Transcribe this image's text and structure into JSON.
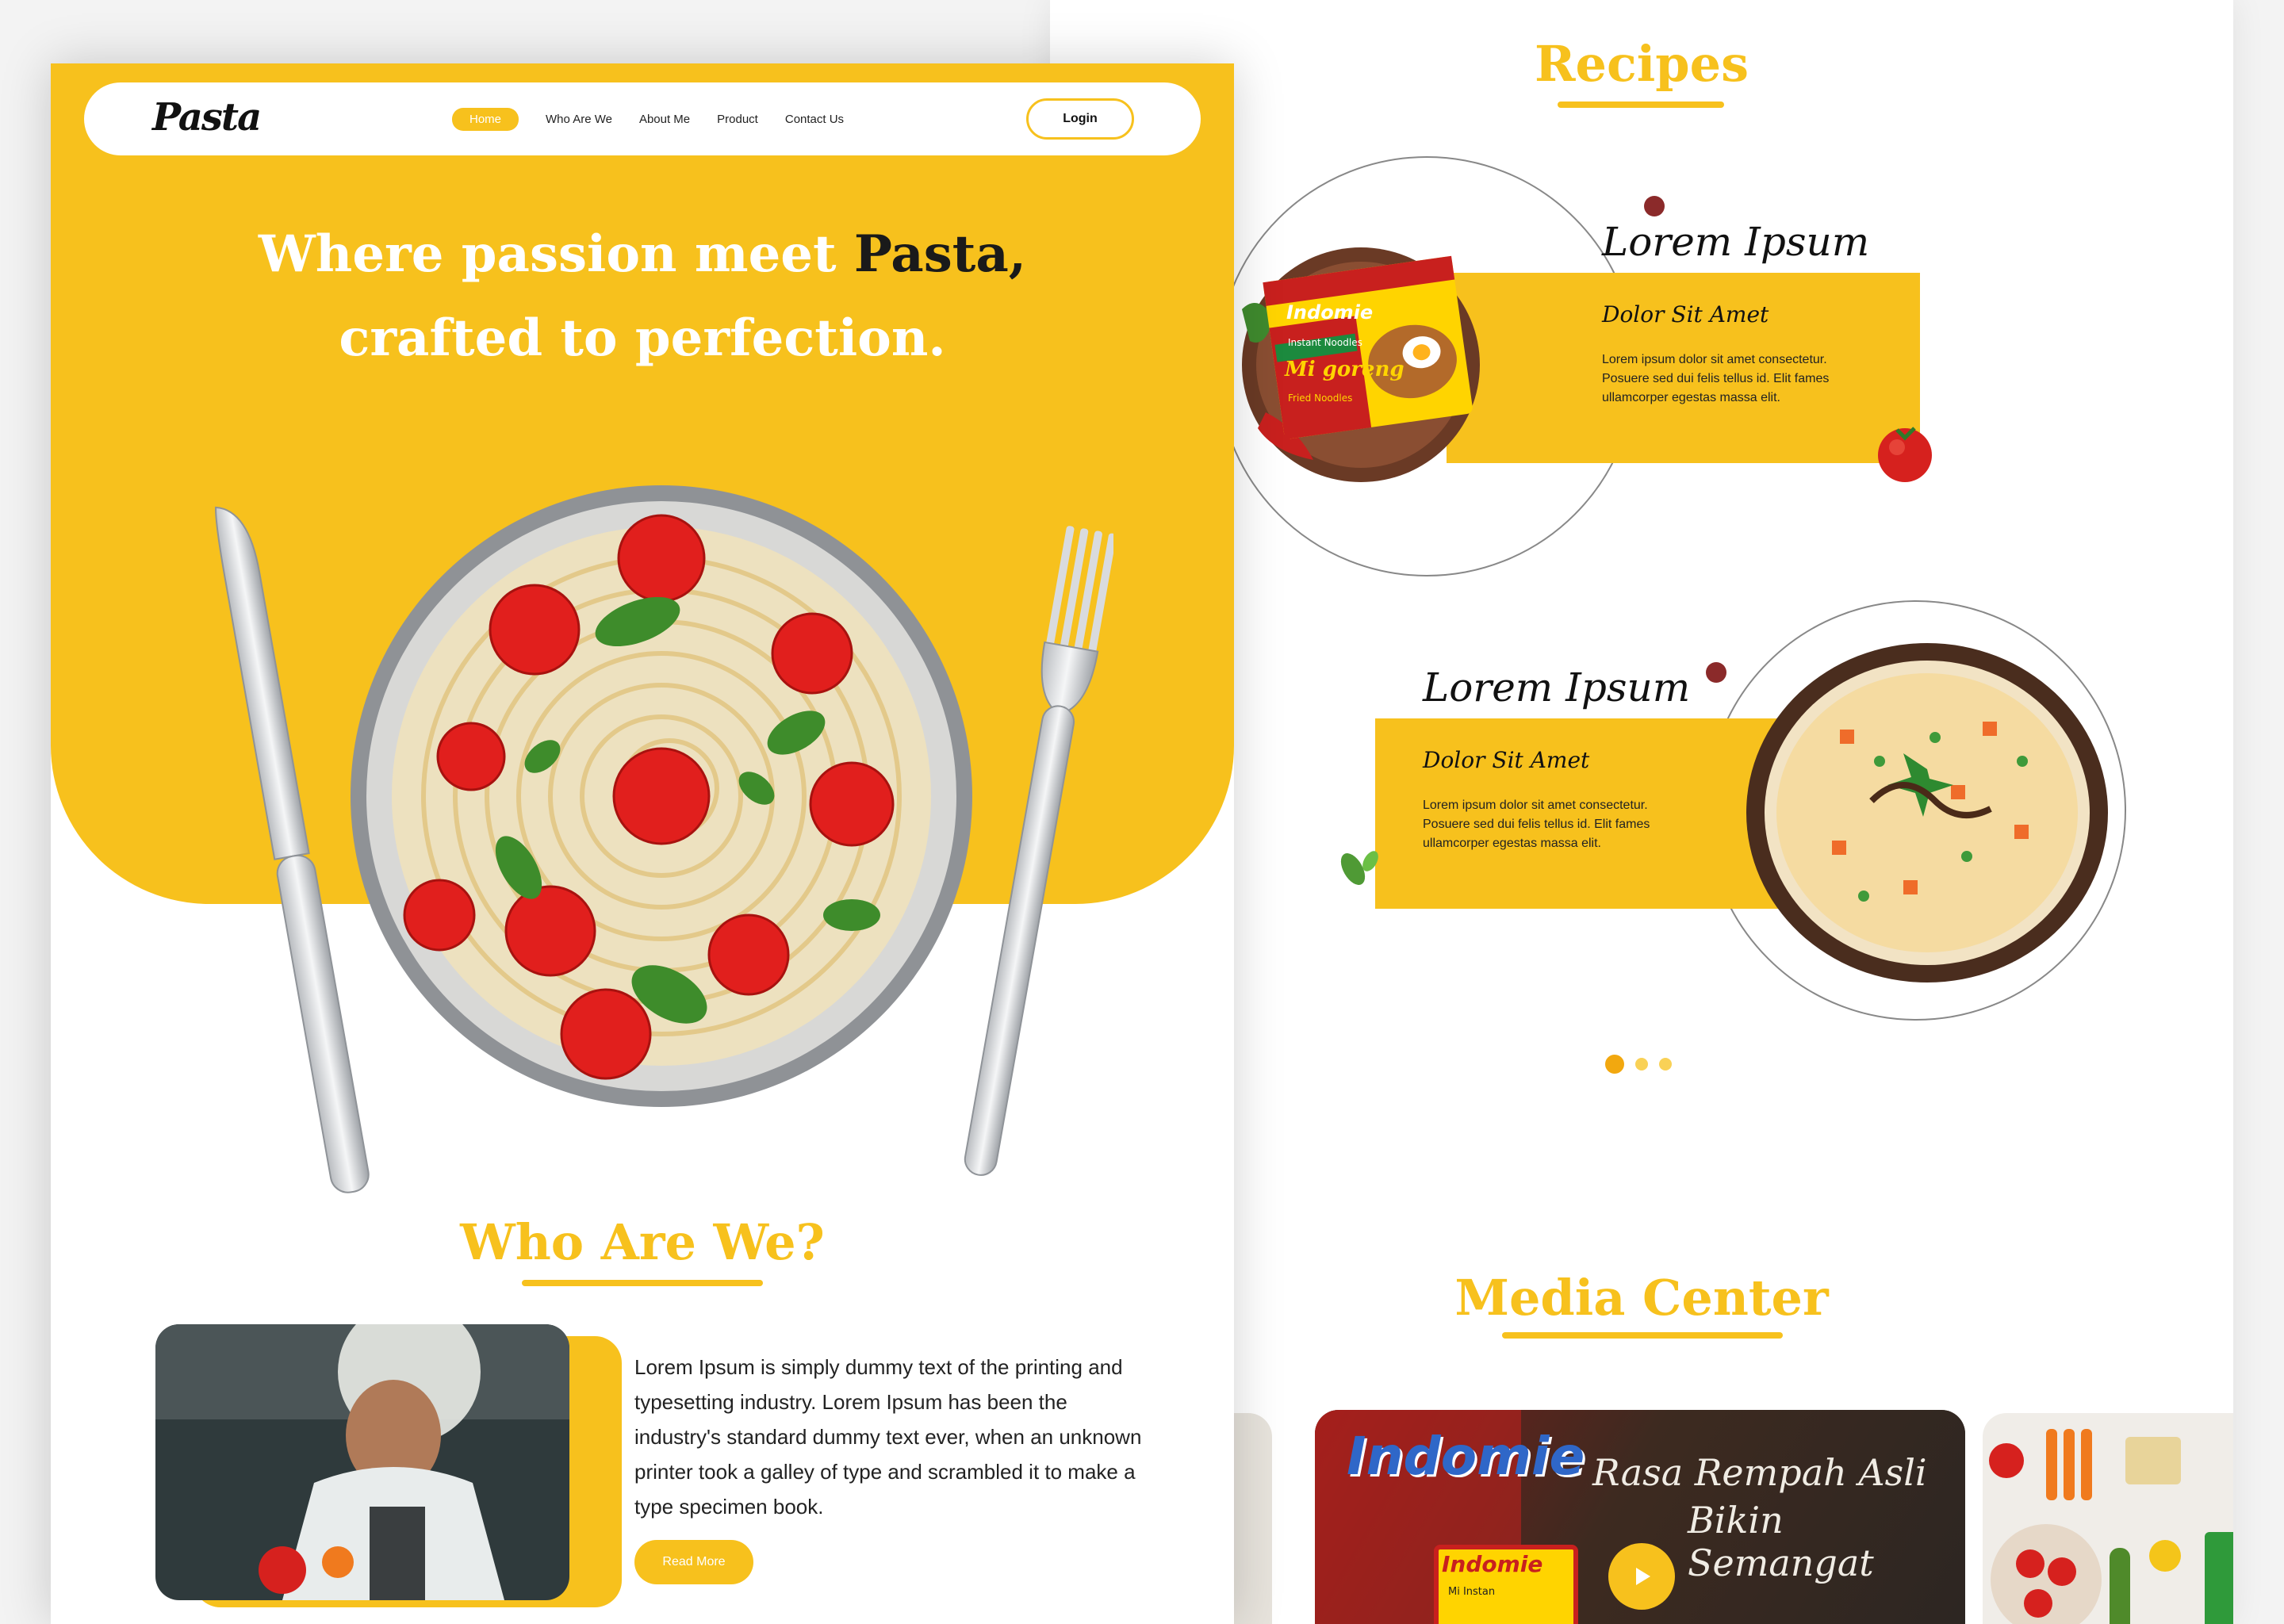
{
  "nav": {
    "logo": "Pasta",
    "links": [
      "Home",
      "Who Are We",
      "About Me",
      "Product",
      "Contact Us"
    ],
    "login": "Login"
  },
  "hero": {
    "line1_part1": "Where passion meet ",
    "line1_highlight": "Pasta,",
    "line2": "crafted to perfection."
  },
  "who": {
    "title": "Who Are We?",
    "text": "Lorem Ipsum is simply dummy text of the printing and typesetting industry. Lorem Ipsum has been the industry's standard dummy text ever, when an unknown printer took a galley of type and scrambled it to make a type specimen book.",
    "button": "Read More"
  },
  "recipes": {
    "title": "Recipes",
    "cards": [
      {
        "title": "Lorem Ipsum",
        "subtitle": "Dolor Sit Amet",
        "text": "Lorem ipsum dolor sit amet consectetur. Posuere sed dui felis tellus id. Elit fames ullamcorper egestas massa elit."
      },
      {
        "title": "Lorem Ipsum",
        "subtitle": "Dolor Sit Amet",
        "text": "Lorem ipsum dolor sit amet consectetur. Posuere sed dui felis tellus id. Elit fames ullamcorper egestas massa elit."
      }
    ],
    "pack": {
      "brand": "Indomie",
      "tag": "Instant Noodles",
      "name": "Mi goreng",
      "variant": "Fried Noodles"
    }
  },
  "media": {
    "title": "Media Center",
    "brand": "Indomie",
    "tagline1": "Rasa Rempah Asli",
    "tagline2": "Bikin Semangat",
    "pack_label": "Mi Instan"
  },
  "colors": {
    "accent": "#f7c11d",
    "accent_dark": "#f2a80f",
    "text": "#1a1a1a"
  }
}
